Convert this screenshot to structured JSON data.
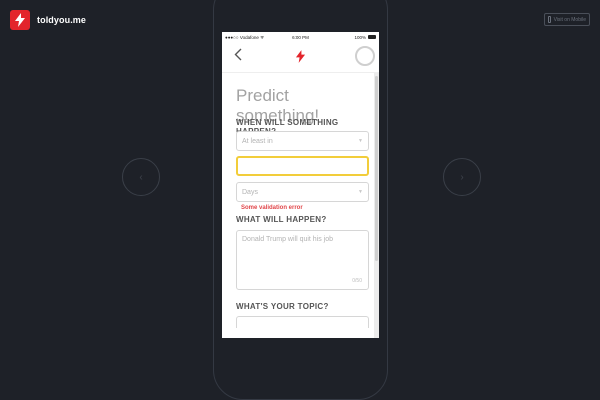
{
  "brand": {
    "name": "toldyou.me"
  },
  "view_mobile": {
    "label": "Visit on Mobile"
  },
  "status_bar": {
    "carrier": "●●●○○ Vodafone ᯤ",
    "time": "6:00 PM",
    "battery": "100%"
  },
  "header": {
    "back_icon": "chevron-left-icon",
    "logo_icon": "lightning-bolt-icon"
  },
  "form": {
    "title": "Predict something!",
    "when_label": "WHEN WILL SOMETHING HAPPEN?",
    "when_select_value": "At least in",
    "amount_value": "",
    "unit_select_value": "Days",
    "validation_error": "Some validation error",
    "what_label": "WHAT WILL HAPPEN?",
    "what_placeholder": "Donald Trump will quit his job",
    "char_counter": "0/50",
    "topic_label": "WHAT'S YOUR TOPIC?"
  },
  "colors": {
    "accent": "#e3242b",
    "focus": "#f2cd3a",
    "error": "#e1464a",
    "background": "#1e2128"
  }
}
